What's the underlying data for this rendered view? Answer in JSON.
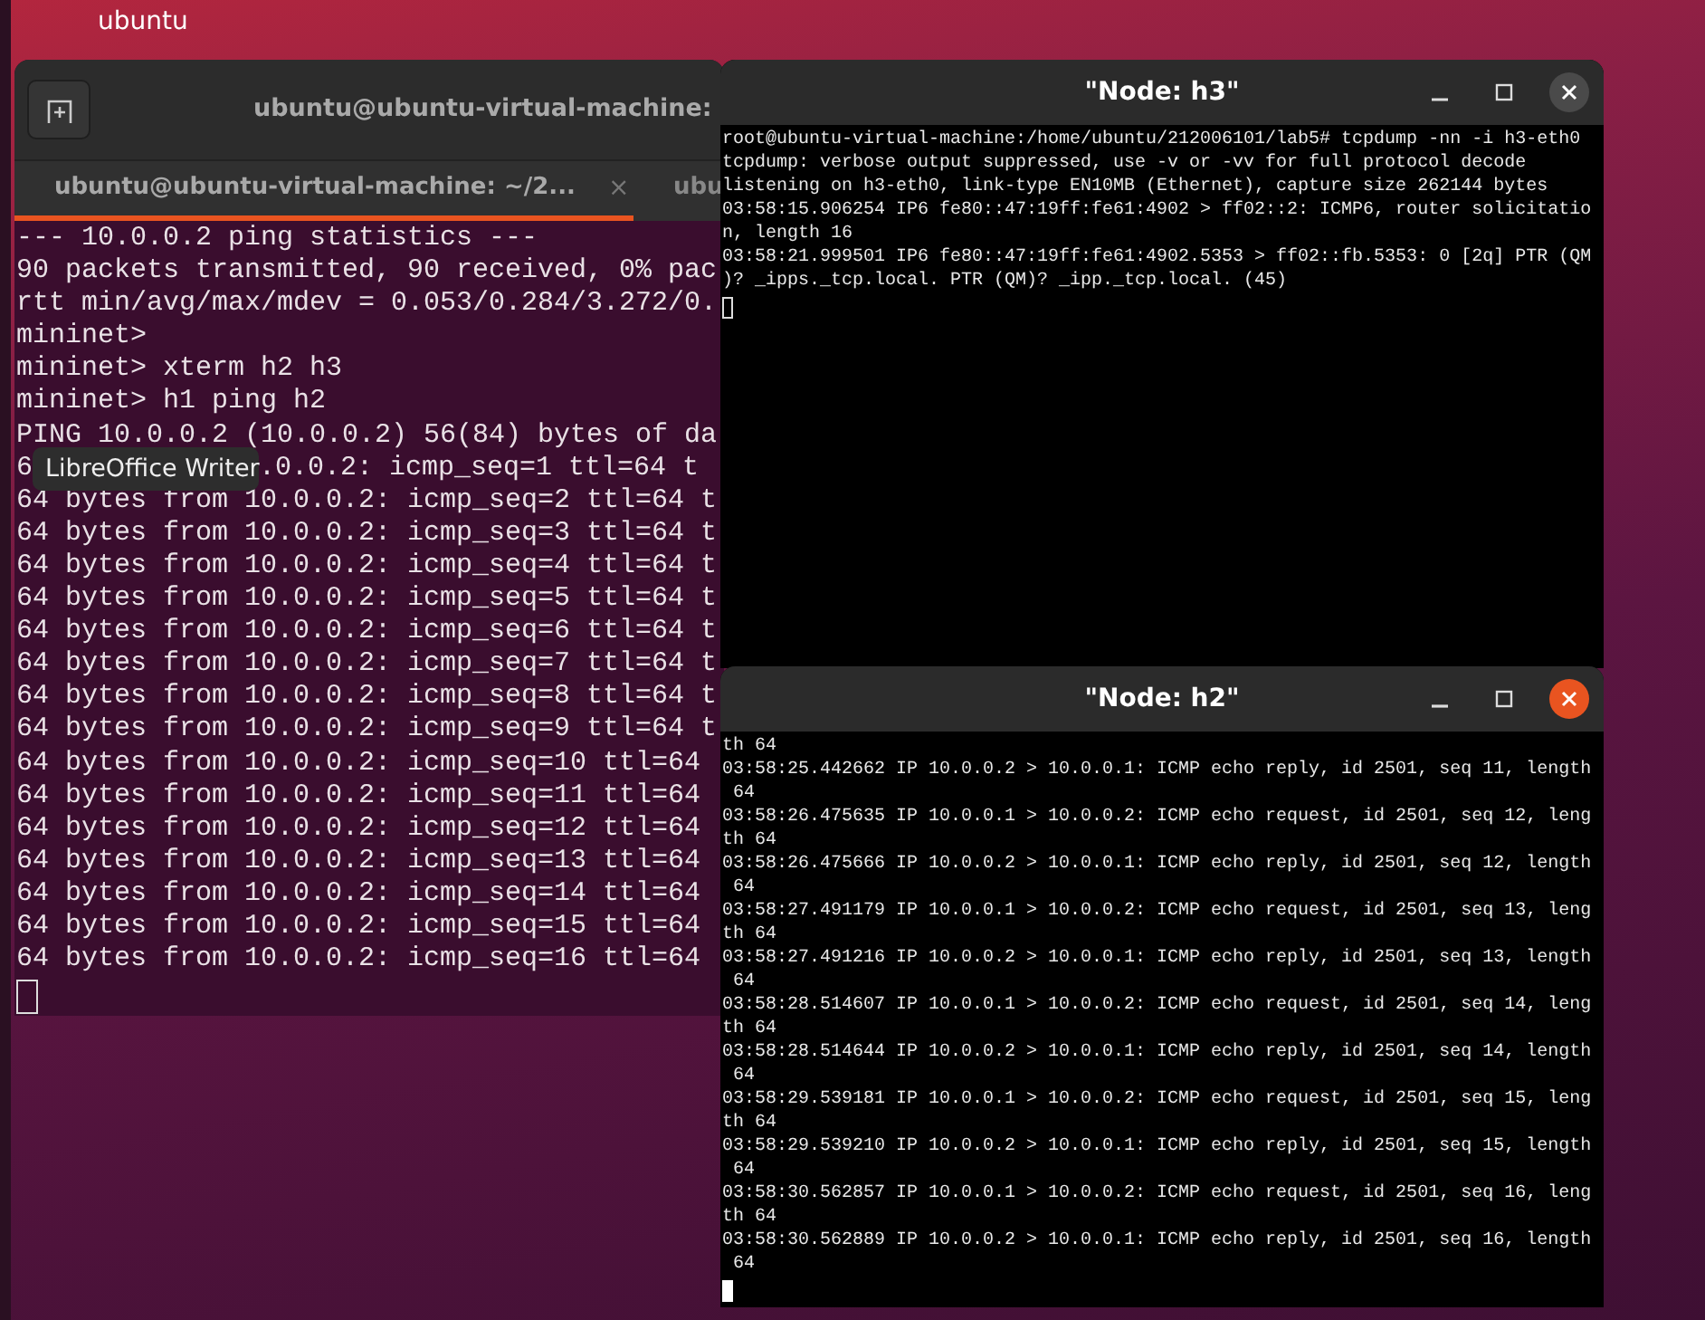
{
  "desktop": {
    "label": "ubuntu"
  },
  "terminal": {
    "title": "ubuntu@ubuntu-virtual-machine:",
    "tabs": [
      {
        "label": "ubuntu@ubuntu-virtual-machine: ~/2...",
        "close": "×",
        "selected": true
      },
      {
        "label": "ubu",
        "selected": false
      }
    ],
    "lines": [
      {
        "kind": "text",
        "text": "--- 10.0.0.2 ping statistics ---"
      },
      {
        "kind": "text",
        "text": "90 packets transmitted, 90 received, 0% pac"
      },
      {
        "kind": "text",
        "text": "rtt min/avg/max/mdev = 0.053/0.284/3.272/0."
      },
      {
        "kind": "text",
        "text": "mininet>"
      },
      {
        "kind": "text",
        "text": "mininet> xterm h2 h3"
      },
      {
        "kind": "text",
        "text": "mininet> h1 ping h2"
      },
      {
        "kind": "text",
        "text": "PING 10.0.0.2 (10.0.0.2) 56(84) bytes of da"
      },
      {
        "kind": "tooltip",
        "before": "6",
        "tooltip": "LibreOffice Writer",
        "after": ".0.0.2: icmp_seq=1 ttl=64 t"
      },
      {
        "kind": "text",
        "text": "64 bytes from 10.0.0.2: icmp_seq=2 ttl=64 t"
      },
      {
        "kind": "text",
        "text": "64 bytes from 10.0.0.2: icmp_seq=3 ttl=64 t"
      },
      {
        "kind": "text",
        "text": "64 bytes from 10.0.0.2: icmp_seq=4 ttl=64 t"
      },
      {
        "kind": "text",
        "text": "64 bytes from 10.0.0.2: icmp_seq=5 ttl=64 t"
      },
      {
        "kind": "text",
        "text": "64 bytes from 10.0.0.2: icmp_seq=6 ttl=64 t"
      },
      {
        "kind": "text",
        "text": "64 bytes from 10.0.0.2: icmp_seq=7 ttl=64 t"
      },
      {
        "kind": "text",
        "text": "64 bytes from 10.0.0.2: icmp_seq=8 ttl=64 t"
      },
      {
        "kind": "text",
        "text": "64 bytes from 10.0.0.2: icmp_seq=9 ttl=64 t"
      },
      {
        "kind": "text",
        "text": "64 bytes from 10.0.0.2: icmp_seq=10 ttl=64"
      },
      {
        "kind": "text",
        "text": "64 bytes from 10.0.0.2: icmp_seq=11 ttl=64"
      },
      {
        "kind": "text",
        "text": "64 bytes from 10.0.0.2: icmp_seq=12 ttl=64"
      },
      {
        "kind": "text",
        "text": "64 bytes from 10.0.0.2: icmp_seq=13 ttl=64"
      },
      {
        "kind": "text",
        "text": "64 bytes from 10.0.0.2: icmp_seq=14 ttl=64"
      },
      {
        "kind": "text",
        "text": "64 bytes from 10.0.0.2: icmp_seq=15 ttl=64"
      },
      {
        "kind": "text",
        "text": "64 bytes from 10.0.0.2: icmp_seq=16 ttl=64"
      }
    ],
    "cursor": {
      "filled": false
    }
  },
  "xterms": [
    {
      "title": "\"Node: h3\"",
      "focused": false,
      "cursor": {
        "filled": false
      },
      "lines": [
        "root@ubuntu-virtual-machine:/home/ubuntu/212006101/lab5# tcpdump -nn -i h3-eth0",
        "tcpdump: verbose output suppressed, use -v or -vv for full protocol decode",
        "listening on h3-eth0, link-type EN10MB (Ethernet), capture size 262144 bytes",
        "03:58:15.906254 IP6 fe80::47:19ff:fe61:4902 > ff02::2: ICMP6, router solicitatio",
        "n, length 16",
        "03:58:21.999501 IP6 fe80::47:19ff:fe61:4902.5353 > ff02::fb.5353: 0 [2q] PTR (QM",
        ")? _ipps._tcp.local. PTR (QM)? _ipp._tcp.local. (45)"
      ]
    },
    {
      "title": "\"Node: h2\"",
      "focused": true,
      "cursor": {
        "filled": true
      },
      "lines": [
        "th 64",
        "03:58:25.442662 IP 10.0.0.2 > 10.0.0.1: ICMP echo reply, id 2501, seq 11, length",
        " 64",
        "03:58:26.475635 IP 10.0.0.1 > 10.0.0.2: ICMP echo request, id 2501, seq 12, leng",
        "th 64",
        "03:58:26.475666 IP 10.0.0.2 > 10.0.0.1: ICMP echo reply, id 2501, seq 12, length",
        " 64",
        "03:58:27.491179 IP 10.0.0.1 > 10.0.0.2: ICMP echo request, id 2501, seq 13, leng",
        "th 64",
        "03:58:27.491216 IP 10.0.0.2 > 10.0.0.1: ICMP echo reply, id 2501, seq 13, length",
        " 64",
        "03:58:28.514607 IP 10.0.0.1 > 10.0.0.2: ICMP echo request, id 2501, seq 14, leng",
        "th 64",
        "03:58:28.514644 IP 10.0.0.2 > 10.0.0.1: ICMP echo reply, id 2501, seq 14, length",
        " 64",
        "03:58:29.539181 IP 10.0.0.1 > 10.0.0.2: ICMP echo request, id 2501, seq 15, leng",
        "th 64",
        "03:58:29.539210 IP 10.0.0.2 > 10.0.0.1: ICMP echo reply, id 2501, seq 15, length",
        " 64",
        "03:58:30.562857 IP 10.0.0.1 > 10.0.0.2: ICMP echo request, id 2501, seq 16, leng",
        "th 64",
        "03:58:30.562889 IP 10.0.0.2 > 10.0.0.1: ICMP echo reply, id 2501, seq 16, length",
        " 64"
      ]
    }
  ]
}
